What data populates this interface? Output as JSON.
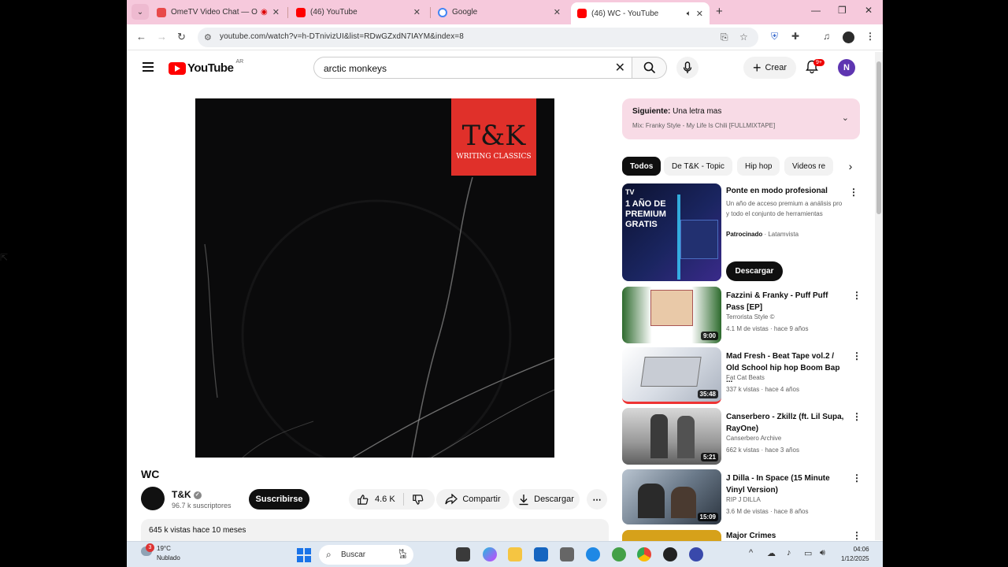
{
  "browser": {
    "tabs": [
      {
        "title": "OmeTV Video Chat — Omegle",
        "favicon_color": "#e84a4a"
      },
      {
        "title": "(46) YouTube",
        "favicon_color": "#ff0000"
      },
      {
        "title": "Google",
        "favicon_color": "#4285f4"
      },
      {
        "title": "(46) WC - YouTube",
        "favicon_color": "#ff0000"
      }
    ],
    "url": "youtube.com/watch?v=h-DTnivizUI&list=RDwGZxdN7IAYM&index=8"
  },
  "yt": {
    "region": "AR",
    "logo_text": "YouTube",
    "search_query": "arctic monkeys",
    "create_label": "Crear",
    "notif_count": "9+",
    "avatar_letter": "N"
  },
  "player": {
    "badge_big": "T&K",
    "badge_small": "WRITING CLASSICS"
  },
  "video": {
    "title": "WC",
    "channel": "T&K",
    "subscribers": "96.7 k suscriptores",
    "subscribe_label": "Suscribirse",
    "likes": "4.6 K",
    "share_label": "Compartir",
    "download_label": "Descargar",
    "views_age": "645 k vistas  hace 10 meses"
  },
  "upnext": {
    "label": "Siguiente:",
    "title": "Una letra mas",
    "mix": "Mix: Franky Style - My Life Is Chili [FULLMIXTAPE]"
  },
  "chips": [
    "Todos",
    "De T&K - Topic",
    "Hip hop",
    "Videos re"
  ],
  "ad": {
    "title": "Ponte en modo profesional",
    "desc": "Un año de acceso premium a análisis pro y todo el conjunto de herramientas",
    "sponsored": "Patrocinado",
    "advertiser": "Latamvista",
    "cta": "Descargar",
    "thumb_text": "1 AÑO DE PREMIUM GRATIS"
  },
  "recommendations": [
    {
      "title": "Fazzini & Franky - Puff Puff Pass [EP]",
      "channel": "Terrorista Style ©",
      "meta": "4.1 M de vistas · hace 9 años",
      "duration": "9:00"
    },
    {
      "title": "Mad Fresh - Beat Tape vol.2 / Old School hip hop Boom Bap ...",
      "channel": "Fat Cat Beats",
      "meta": "337 k vistas · hace 4 años",
      "duration": "35:48"
    },
    {
      "title": "Canserbero - Zkillz (ft. Lil Supa, RayOne)",
      "channel": "Canserbero Archive",
      "meta": "662 k vistas · hace 3 años",
      "duration": "5:21"
    },
    {
      "title": "J Dilla - In Space (15 Minute Vinyl Version)",
      "channel": "RIP J DILLA",
      "meta": "3.6 M de vistas · hace 8 años",
      "duration": "15:09"
    },
    {
      "title": "Major Crimes",
      "channel": "",
      "meta": "",
      "duration": ""
    }
  ],
  "taskbar": {
    "weather_badge": "3",
    "temp": "19°C",
    "condition": "Nublado",
    "search": "Buscar",
    "time": "04:06",
    "date": "1/12/2025"
  }
}
